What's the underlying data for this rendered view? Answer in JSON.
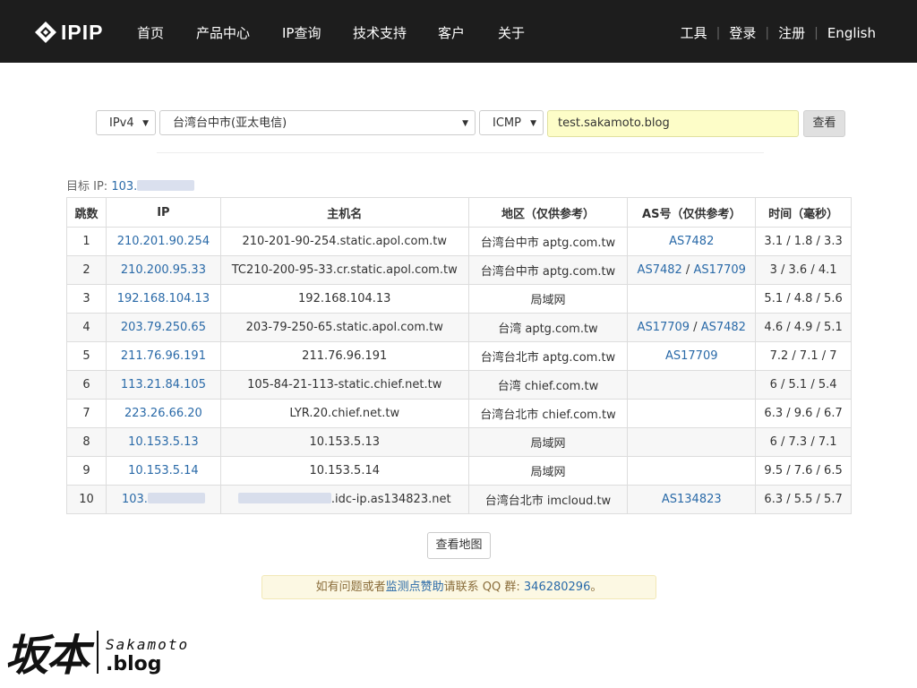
{
  "header": {
    "logo_text": "IPIP",
    "nav": [
      "首页",
      "产品中心",
      "IP查询",
      "技术支持",
      "客户",
      "关于"
    ],
    "right": [
      "工具",
      "登录",
      "注册",
      "English"
    ]
  },
  "form": {
    "ip_version": "IPv4",
    "node": "台湾台中市(亚太电信)",
    "protocol": "ICMP",
    "host": "test.sakamoto.blog",
    "submit": "查看"
  },
  "target": {
    "label": "目标 IP:",
    "value": "103."
  },
  "table": {
    "headers": [
      "跳数",
      "IP",
      "主机名",
      "地区（仅供参考）",
      "AS号（仅供参考）",
      "时间（毫秒）"
    ],
    "rows": [
      {
        "hop": "1",
        "ip": "210.201.90.254",
        "host": "210-201-90-254.static.apol.com.tw",
        "region": "台湾台中市 aptg.com.tw",
        "as": [
          "AS7482"
        ],
        "time": "3.1 / 1.8 / 3.3"
      },
      {
        "hop": "2",
        "ip": "210.200.95.33",
        "host": "TC210-200-95-33.cr.static.apol.com.tw",
        "region": "台湾台中市 aptg.com.tw",
        "as": [
          "AS7482",
          "AS17709"
        ],
        "time": "3 / 3.6 / 4.1"
      },
      {
        "hop": "3",
        "ip": "192.168.104.13",
        "host": "192.168.104.13",
        "region": "局域网",
        "as": [],
        "time": "5.1 / 4.8 / 5.6"
      },
      {
        "hop": "4",
        "ip": "203.79.250.65",
        "host": "203-79-250-65.static.apol.com.tw",
        "region": "台湾 aptg.com.tw",
        "as": [
          "AS17709",
          "AS7482"
        ],
        "time": "4.6 / 4.9 / 5.1"
      },
      {
        "hop": "5",
        "ip": "211.76.96.191",
        "host": "211.76.96.191",
        "region": "台湾台北市 aptg.com.tw",
        "as": [
          "AS17709"
        ],
        "time": "7.2 / 7.1 / 7"
      },
      {
        "hop": "6",
        "ip": "113.21.84.105",
        "host": "105-84-21-113-static.chief.net.tw",
        "region": "台湾 chief.com.tw",
        "as": [],
        "time": "6 / 5.1 / 5.4"
      },
      {
        "hop": "7",
        "ip": "223.26.66.20",
        "host": "LYR.20.chief.net.tw",
        "region": "台湾台北市 chief.com.tw",
        "as": [],
        "time": "6.3 / 9.6 / 6.7"
      },
      {
        "hop": "8",
        "ip": "10.153.5.13",
        "host": "10.153.5.13",
        "region": "局域网",
        "as": [],
        "time": "6 / 7.3 / 7.1"
      },
      {
        "hop": "9",
        "ip": "10.153.5.14",
        "host": "10.153.5.14",
        "region": "局域网",
        "as": [],
        "time": "9.5 / 7.6 / 6.5"
      },
      {
        "hop": "10",
        "ip": "103.",
        "host": ".idc-ip.as134823.net",
        "region": "台湾台北市 imcloud.tw",
        "as": [
          "AS134823"
        ],
        "time": "6.3 / 5.5 / 5.7",
        "blurred": true
      }
    ]
  },
  "map_button": "查看地图",
  "notice": {
    "prefix": "如有问题或者",
    "link": "监测点赞助",
    "middle": "请联系 QQ 群: ",
    "qq": "346280296",
    "suffix": "。"
  },
  "watermark": {
    "cn": "坂本",
    "en": "Sakamoto",
    "blog": ".blog"
  },
  "colors": {
    "header_bg": "#1d1d1d",
    "link": "#2a6aa8",
    "input_bg": "#fdfdc8",
    "notice_bg": "#fcf8e3"
  }
}
